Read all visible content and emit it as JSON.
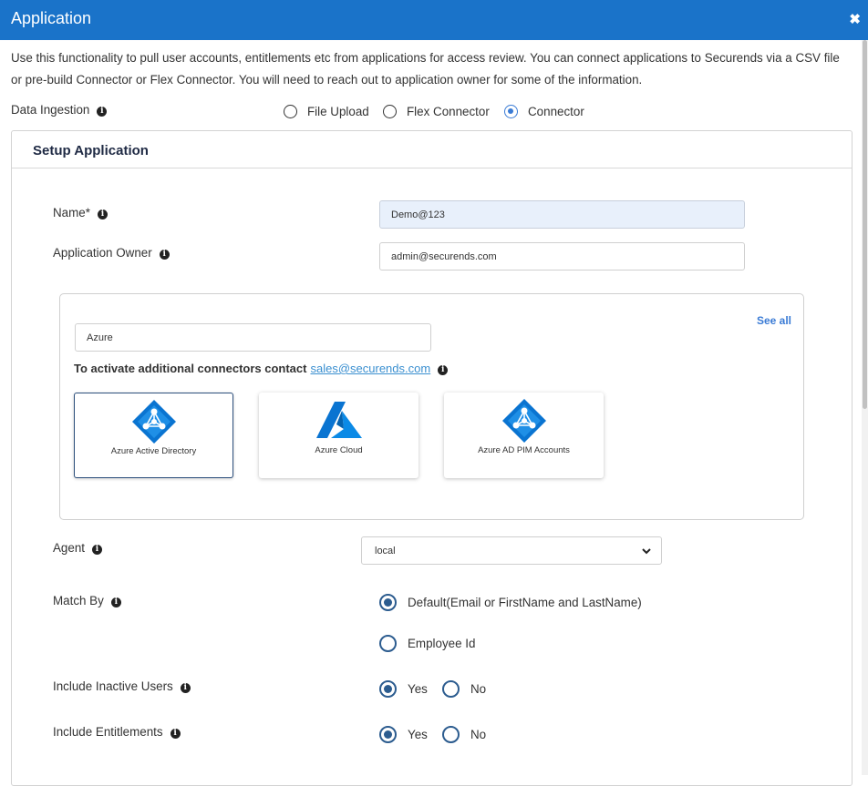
{
  "window": {
    "title": "Application",
    "close_glyph": "✖"
  },
  "intro_text": "Use this functionality to pull user accounts, entitlements etc from applications for access review. You can connect applications to Securends via a CSV file or pre-build Connector or Flex Connector. You will need to reach out to application owner for some of the information.",
  "data_ingestion": {
    "label": "Data Ingestion",
    "options": [
      "File Upload",
      "Flex Connector",
      "Connector"
    ],
    "selected": "Connector"
  },
  "setup": {
    "title": "Setup Application",
    "name_label": "Name*",
    "name_value": "Demo@123",
    "owner_label": "Application Owner",
    "owner_value": "admin@securends.com"
  },
  "connectors": {
    "search_value": "Azure",
    "see_all": "See all",
    "activate_text": "To activate additional connectors contact",
    "sales_email": "sales@securends.com",
    "cards": [
      {
        "label": "Azure Active Directory",
        "icon": "azure-ad-icon",
        "selected": true
      },
      {
        "label": "Azure Cloud",
        "icon": "azure-logo-icon",
        "selected": false
      },
      {
        "label": "Azure AD PIM Accounts",
        "icon": "azure-ad-icon",
        "selected": false
      }
    ]
  },
  "agent": {
    "label": "Agent",
    "value": "local"
  },
  "match_by": {
    "label": "Match By",
    "options": [
      "Default(Email or FirstName and LastName)",
      "Employee Id"
    ],
    "selected": "Default(Email or FirstName and LastName)"
  },
  "include_inactive": {
    "label": "Include Inactive Users",
    "yes": "Yes",
    "no": "No",
    "selected": "Yes"
  },
  "include_entitlements": {
    "label": "Include Entitlements",
    "yes": "Yes",
    "no": "No",
    "selected": "Yes"
  },
  "colors": {
    "header": "#1a73c9",
    "accent": "#3a7bd5",
    "radio_dark": "#2c5c8f",
    "link": "#3a8fd0",
    "azure": "#0a74d1"
  }
}
